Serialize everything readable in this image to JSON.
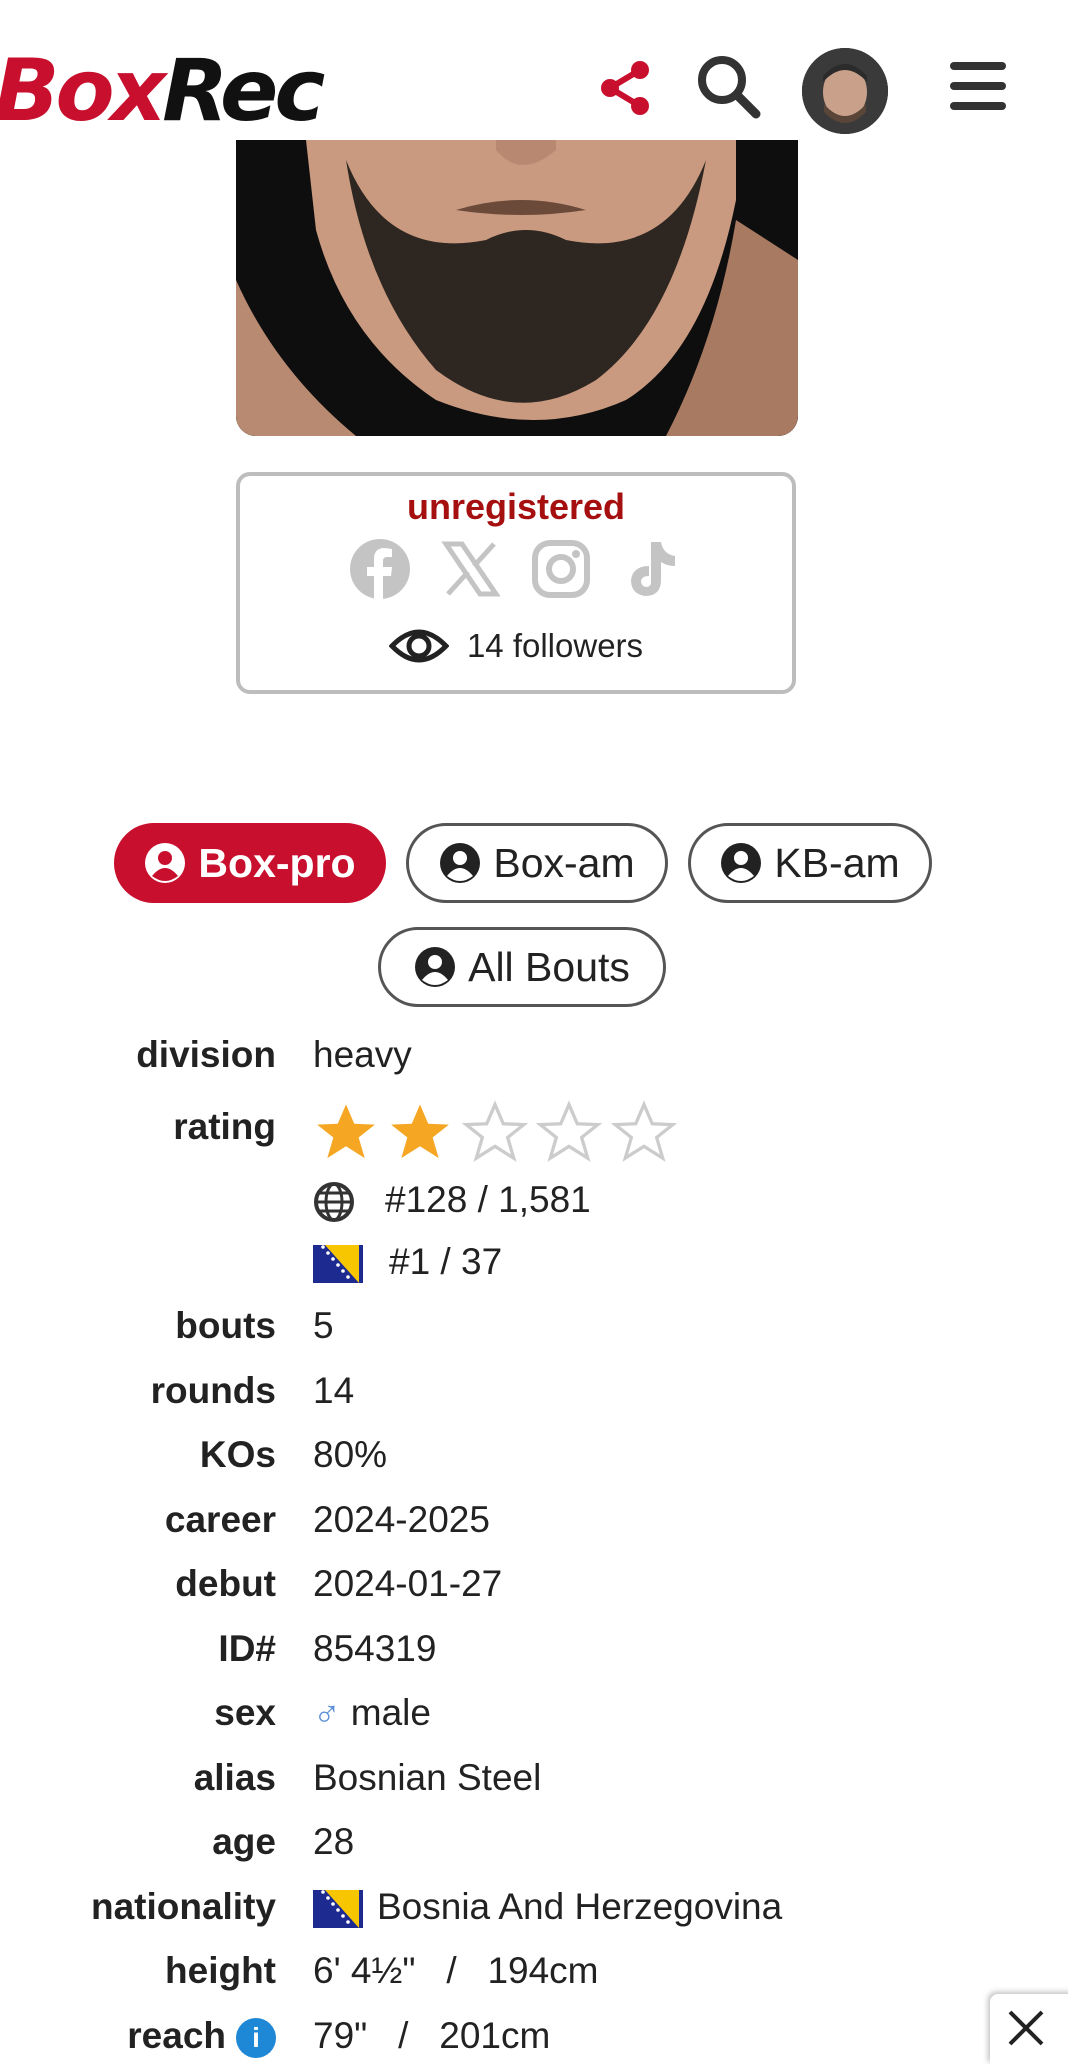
{
  "header": {
    "logo_part1": "Box",
    "logo_part2": "Rec",
    "icons": [
      "share-icon",
      "search-icon",
      "avatar",
      "menu-icon"
    ],
    "brand_color": "#c8102e"
  },
  "profile": {
    "status": "unregistered",
    "social_icons": [
      "facebook-icon",
      "x-icon",
      "instagram-icon",
      "tiktok-icon"
    ],
    "followers": "14 followers"
  },
  "tabs": [
    {
      "label": "Box-pro",
      "active": true
    },
    {
      "label": "Box-am",
      "active": false
    },
    {
      "label": "KB-am",
      "active": false
    },
    {
      "label": "All Bouts",
      "active": false
    }
  ],
  "info": {
    "division": {
      "label": "division",
      "value": "heavy"
    },
    "rating": {
      "label": "rating",
      "stars_filled": 2,
      "stars_total": 5
    },
    "world_rank": "#128 / 1,581",
    "country_rank": "#1 / 37",
    "bouts": {
      "label": "bouts",
      "value": "5"
    },
    "rounds": {
      "label": "rounds",
      "value": "14"
    },
    "kos": {
      "label": "KOs",
      "value": "80%"
    },
    "career": {
      "label": "career",
      "value": "2024-2025"
    },
    "debut": {
      "label": "debut",
      "value": "2024-01-27"
    },
    "id": {
      "label": "ID#",
      "value": "854319"
    },
    "sex": {
      "label": "sex",
      "symbol": "♂",
      "value": "male"
    },
    "alias": {
      "label": "alias",
      "value": "Bosnian Steel"
    },
    "age": {
      "label": "age",
      "value": "28"
    },
    "nationality": {
      "label": "nationality",
      "value": "Bosnia And Herzegovina"
    },
    "height": {
      "label": "height",
      "value": "6' 4½\"   /   194cm"
    },
    "reach": {
      "label": "reach",
      "info": "i",
      "value": "79\"   /   201cm"
    }
  },
  "colors": {
    "star": "#f5a623",
    "star_empty": "#cccccc",
    "unregistered": "#a50f0f"
  }
}
